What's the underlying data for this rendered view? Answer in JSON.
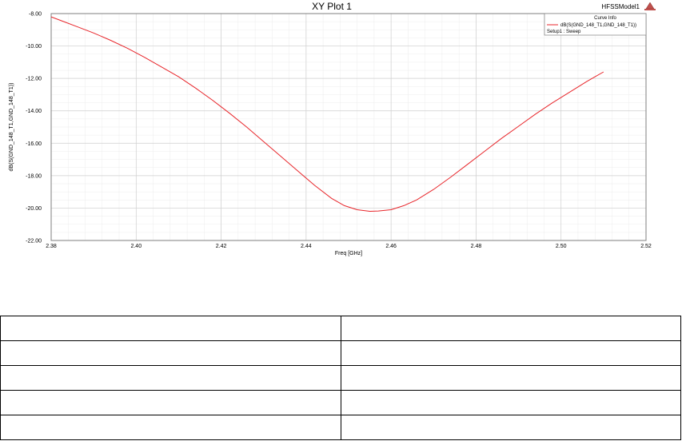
{
  "model_name": "HFSSModel1",
  "chart_data": {
    "type": "line",
    "title": "XY Plot 1",
    "xlabel": "Freq [GHz]",
    "ylabel": "dB(S(GND_148_T1,GND_148_T1))",
    "xlim": [
      2.38,
      2.52
    ],
    "ylim": [
      -22.0,
      -8.0
    ],
    "x_ticks": [
      "2.38",
      "2.40",
      "2.42",
      "2.44",
      "2.46",
      "2.48",
      "2.50",
      "2.52"
    ],
    "y_ticks": [
      "-8.00",
      "-10.00",
      "-12.00",
      "-14.00",
      "-16.00",
      "-18.00",
      "-20.00",
      "-22.00"
    ],
    "grid": true,
    "legend": {
      "title": "Curve Info",
      "entry": "dB(S(GND_148_T1,GND_148_T1))",
      "sub_entry": "Setup1 : Sweep",
      "placement": "top-right"
    },
    "series": [
      {
        "color": "#e8262b",
        "x": [
          2.38,
          2.383,
          2.386,
          2.39,
          2.394,
          2.398,
          2.402,
          2.406,
          2.41,
          2.414,
          2.418,
          2.422,
          2.426,
          2.43,
          2.434,
          2.438,
          2.442,
          2.446,
          2.449,
          2.452,
          2.455,
          2.457,
          2.46,
          2.463,
          2.466,
          2.47,
          2.474,
          2.478,
          2.482,
          2.486,
          2.49,
          2.494,
          2.498,
          2.502,
          2.506,
          2.508,
          2.51
        ],
        "y": [
          -8.2,
          -8.5,
          -8.8,
          -9.2,
          -9.65,
          -10.15,
          -10.7,
          -11.3,
          -11.9,
          -12.6,
          -13.35,
          -14.15,
          -15.0,
          -15.9,
          -16.8,
          -17.7,
          -18.6,
          -19.4,
          -19.85,
          -20.1,
          -20.2,
          -20.18,
          -20.1,
          -19.85,
          -19.5,
          -18.85,
          -18.1,
          -17.3,
          -16.5,
          -15.7,
          -14.95,
          -14.2,
          -13.5,
          -12.85,
          -12.2,
          -11.9,
          -11.6
        ]
      }
    ]
  }
}
